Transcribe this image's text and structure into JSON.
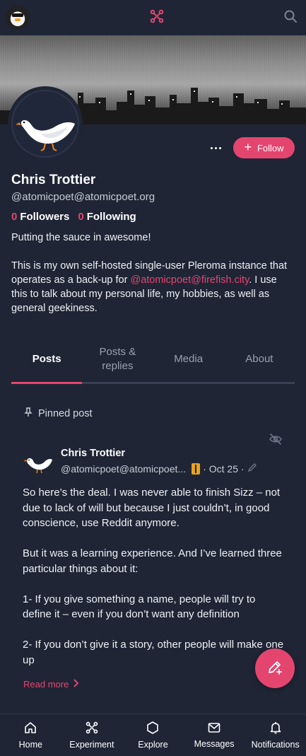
{
  "topbar": {
    "logo_icon": "network-icon",
    "search_icon": "search-icon",
    "accent": "#e4456f"
  },
  "profile": {
    "name": "Chris Trottier",
    "handle": "@atomicpoet@atomicpoet.org",
    "follow_label": "Follow",
    "followers_count": "0",
    "followers_label": "Followers",
    "following_count": "0",
    "following_label": "Following",
    "bio_line1": "Putting the sauce in awesome!",
    "bio_p2_before": "This is my own self-hosted single-user Pleroma instance that operates as a back-up for ",
    "bio_mention": "@atomicpoet@firefish.city",
    "bio_p2_after": ". I use this to talk about my personal life, my hobbies, as well as general geekiness."
  },
  "tabs": [
    {
      "label": "Posts",
      "active": true
    },
    {
      "label": "Posts & replies",
      "active": false
    },
    {
      "label": "Media",
      "active": false
    },
    {
      "label": "About",
      "active": false
    }
  ],
  "post": {
    "pinned_label": "Pinned post",
    "author_name": "Chris Trottier",
    "author_handle": "@atomicpoet@atomicpoet...",
    "date": "Oct 25",
    "paragraphs": [
      "So here’s the deal. I was never able to finish Sizz – not due to lack of will but because I just couldn’t, in good conscience, use Reddit anymore.",
      "But it was a learning experience. And I’ve learned three particular things about it:",
      "1- If you give something a name, people will try to define it – even if you don’t want any definition",
      "2- If you don’t give it a story, other people will make one up"
    ],
    "read_more": "Read more"
  },
  "bottom_nav": [
    {
      "label": "Home",
      "icon": "home-icon"
    },
    {
      "label": "Experiment",
      "icon": "network-icon"
    },
    {
      "label": "Explore",
      "icon": "hexagon-icon"
    },
    {
      "label": "Messages",
      "icon": "mail-icon"
    },
    {
      "label": "Notifications",
      "icon": "bell-icon"
    }
  ]
}
